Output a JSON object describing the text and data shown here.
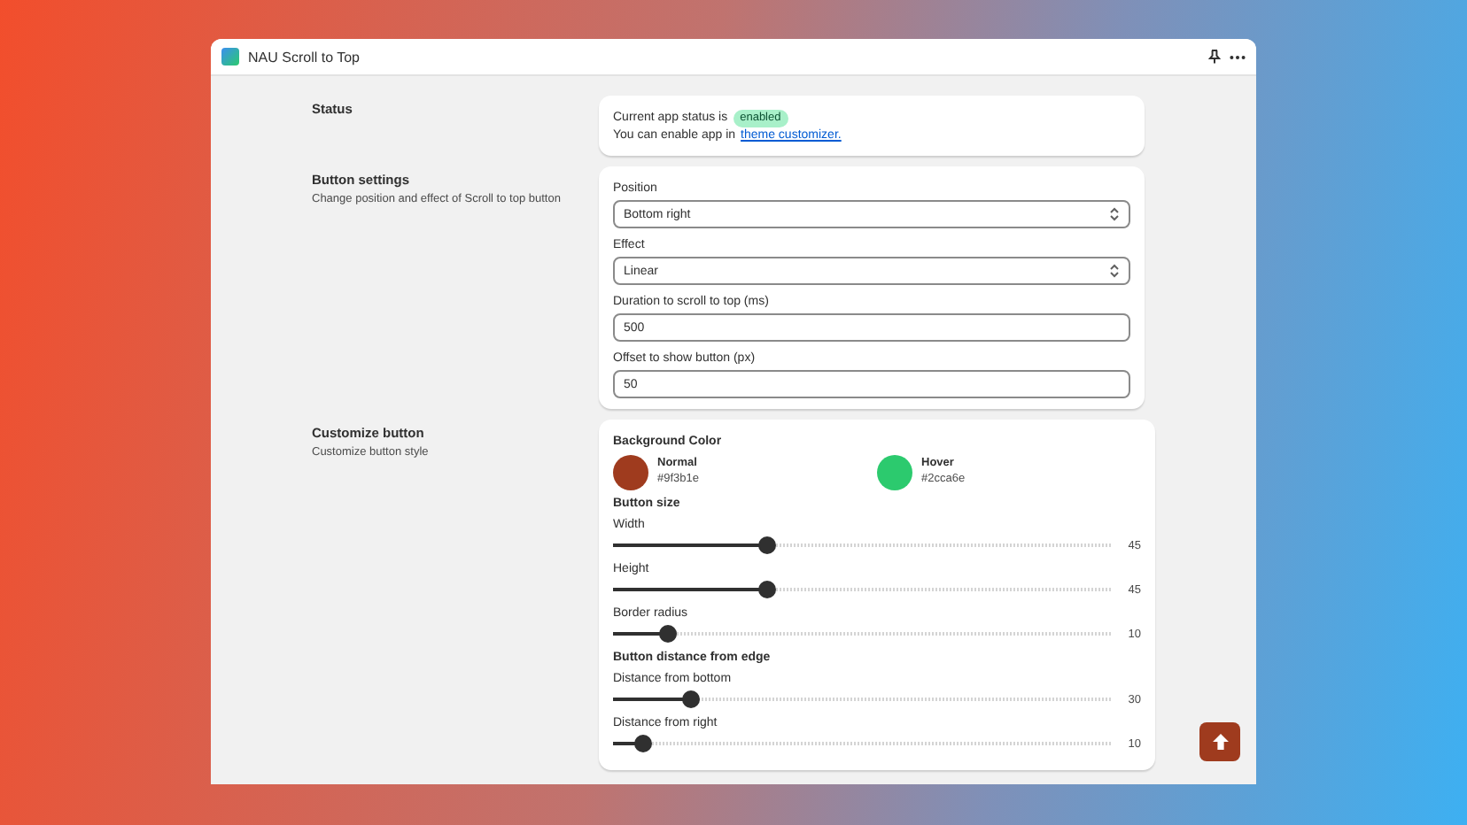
{
  "window": {
    "title": "NAU Scroll to Top"
  },
  "status": {
    "title": "Status",
    "status_text": "Current app status is",
    "badge": "enabled",
    "hint_text": "You can enable app in",
    "link": "theme customizer."
  },
  "button_settings": {
    "title": "Button settings",
    "description": "Change position and effect of Scroll to top button",
    "fields": [
      {
        "label": "Position",
        "value": "Bottom right",
        "kind": "select"
      },
      {
        "label": "Effect",
        "value": "Linear",
        "kind": "select"
      },
      {
        "label": "Duration to scroll to top (ms)",
        "value": "500",
        "kind": "input"
      },
      {
        "label": "Offset to show button (px)",
        "value": "50",
        "kind": "input"
      }
    ]
  },
  "customize": {
    "title": "Customize button",
    "description": "Customize button style",
    "color_heading": "Background Color",
    "colors": [
      {
        "label": "Normal",
        "value": "#9f3b1e",
        "color": "#9f3b1e"
      },
      {
        "label": "Hover",
        "value": "#2cca6e",
        "color": "#2cca6e"
      }
    ],
    "groups": [
      {
        "heading": "Button size",
        "sliders": [
          {
            "label": "Width",
            "level": 0.31,
            "reading": "45"
          },
          {
            "label": "Height",
            "level": 0.31,
            "reading": "45"
          },
          {
            "label": "Border radius",
            "level": 0.11,
            "reading": "10"
          }
        ]
      },
      {
        "heading": "Button distance from edge",
        "sliders": [
          {
            "label": "Distance from bottom",
            "level": 0.155,
            "reading": "30"
          },
          {
            "label": "Distance from right",
            "level": 0.06,
            "reading": "10"
          }
        ]
      }
    ]
  }
}
